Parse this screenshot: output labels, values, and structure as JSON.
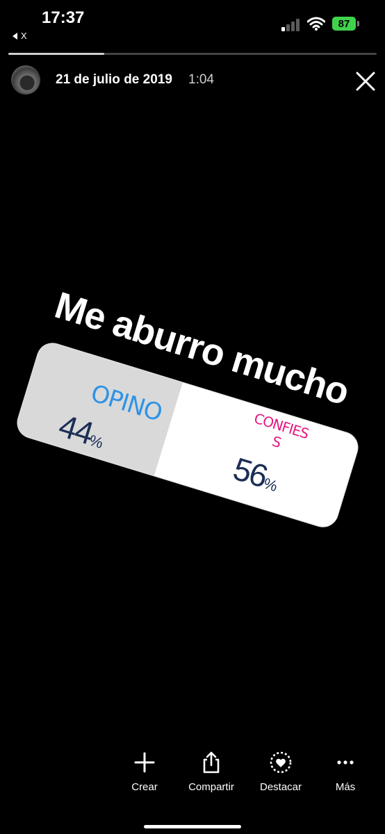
{
  "status_bar": {
    "time": "17:37",
    "back_app_label": "X",
    "battery_level": "87",
    "battery_color": "#3fd34b",
    "signal_icon": "cellular-signal-icon",
    "wifi_icon": "wifi-icon"
  },
  "story": {
    "progress_fraction": 0.26,
    "posted_date": "21 de julio de 2019",
    "posted_time": "1:04",
    "text": "Me aburro mucho",
    "close_icon": "close-icon"
  },
  "poll": {
    "options": [
      {
        "label": "OPINO",
        "percent": 44,
        "percent_sign": "%",
        "color": "#2f93e6"
      },
      {
        "label": "CONFIES\nS",
        "percent": 56,
        "percent_sign": "%",
        "color": "#e8167f"
      }
    ],
    "percent_color": "#1b2e55"
  },
  "actions": [
    {
      "label": "Crear",
      "icon": "plus-icon"
    },
    {
      "label": "Compartir",
      "icon": "share-icon"
    },
    {
      "label": "Destacar",
      "icon": "highlight-heart-icon"
    },
    {
      "label": "Más",
      "icon": "more-icon"
    }
  ]
}
